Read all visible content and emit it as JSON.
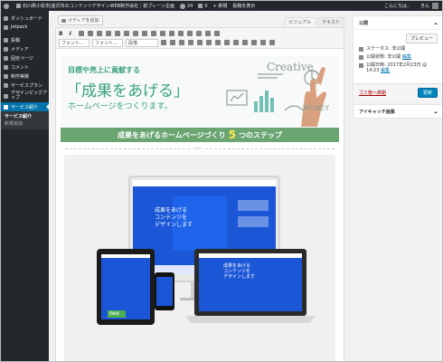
{
  "adminbar": {
    "site_title": "石川県小松市|金沢市のコンテンツデザインWEB制作会社｜創ブレーン企画",
    "updates": "24",
    "comments": "0",
    "new_label": "+ 新規",
    "view_post": "投稿を表示",
    "greeting": "こんにちは、",
    "username": "きん"
  },
  "menu": {
    "items": [
      {
        "label": "ダッシュボード"
      },
      {
        "label": "Jetpack"
      },
      {
        "label": "投稿"
      },
      {
        "label": "メディア"
      },
      {
        "label": "固定ページ"
      },
      {
        "label": "コメント"
      },
      {
        "label": "制作実績"
      },
      {
        "label": "サービスプラン"
      },
      {
        "label": "デザインピックアップ"
      },
      {
        "label": "サービス紹介"
      }
    ],
    "submenu": [
      "サービス紹介",
      "新規追加"
    ]
  },
  "editor": {
    "add_media": "メディアを追加",
    "tab_visual": "ビジュアル",
    "tab_text": "テキスト",
    "font_family": "フォント...",
    "font_size": "フォント...",
    "format": "段落"
  },
  "content": {
    "banner_sub": "目標や売上に貢献する",
    "banner_main": "「成果をあげる」",
    "banner_home": "ホームページをつくります。",
    "banner_art_1": "Creative",
    "banner_art_2": "MONEY",
    "ribbon_before": "成果をあげるホームページづくり",
    "ribbon_num": "5",
    "ribbon_after": "つのステップ",
    "more_tag": "MORE",
    "screen_text_1": "成果をあげる",
    "screen_text_2": "コンテンツを",
    "screen_text_3": "デザインします",
    "screen_text_4": "Web"
  },
  "publish": {
    "title": "公開",
    "preview": "プレビュー",
    "status_label": "ステータス: 非公開",
    "visibility_label": "公開状態: 非公開",
    "visibility_edit": "編集",
    "date_label": "公開日時: 2017年2月23日 @ 14:23",
    "date_edit": "編集",
    "trash": "ゴミ箱へ移動",
    "update": "更新"
  },
  "thumbnail": {
    "title": "アイキャッチ画像"
  },
  "colors": {
    "accent": "#0073aa",
    "menu_bg": "#23282d",
    "brand_green": "#6aa572"
  }
}
